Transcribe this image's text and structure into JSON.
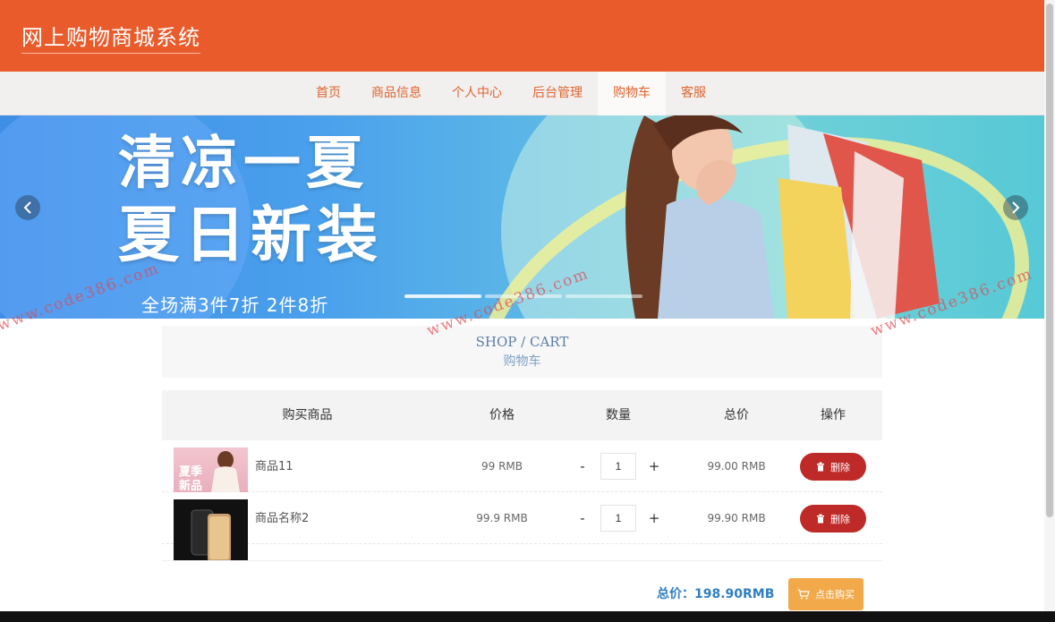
{
  "header": {
    "site_title": "网上购物商城系统"
  },
  "nav": {
    "items": [
      {
        "label": "首页"
      },
      {
        "label": "商品信息"
      },
      {
        "label": "个人中心"
      },
      {
        "label": "后台管理"
      },
      {
        "label": "购物车"
      },
      {
        "label": "客服"
      }
    ],
    "active": "购物车"
  },
  "banner": {
    "line1": "清凉一夏",
    "line2": "夏日新装",
    "subtitle": "全场满3件7折  2件8折",
    "slide_count": 3,
    "active_slide": 1,
    "prev_icon": "chevron-left-icon",
    "next_icon": "chevron-right-icon"
  },
  "section": {
    "title_en": "SHOP / CART",
    "title_cn": "购物车"
  },
  "table": {
    "headers": [
      "购买商品",
      "价格",
      "数量",
      "总价",
      "操作"
    ],
    "rows": [
      {
        "name": "商品11",
        "price": "99 RMB",
        "qty": "1",
        "total": "99.00 RMB",
        "delete_label": "删除",
        "thumb_text": "夏季\n新品"
      },
      {
        "name": "商品名称2",
        "price": "99.9 RMB",
        "qty": "1",
        "total": "99.90 RMB",
        "delete_label": "删除"
      }
    ],
    "minus": "-",
    "plus": "+"
  },
  "footer": {
    "total_label": "总价：",
    "total_value": "198.90RMB",
    "buy_label": "点击购买"
  },
  "watermark": "www.code386.com",
  "colors": {
    "brand": "#e95b2b",
    "nav_text": "#e0632f",
    "delete": "#be2a27",
    "buy": "#f2a94a",
    "total": "#2f7fc3"
  }
}
